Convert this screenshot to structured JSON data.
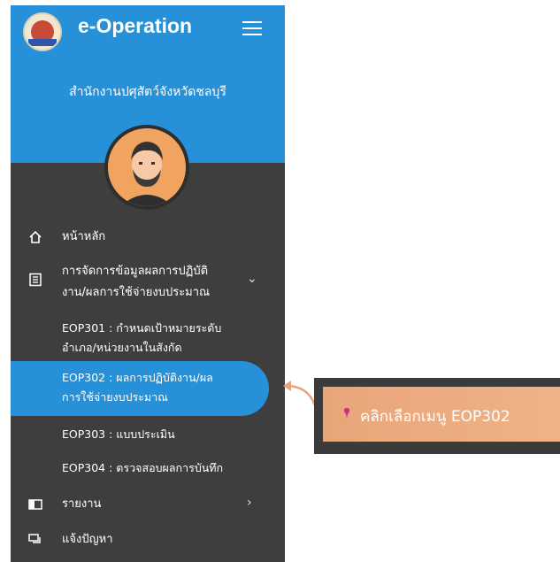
{
  "app": {
    "title": "e-Operation"
  },
  "header": {
    "org_name": "สำนักงานปศุสัตว์จังหวัดชลบุรี"
  },
  "nav": {
    "home": "หน้าหลัก",
    "manage": {
      "line1": "การจัดการข้อมูลผลการปฏิบัติ",
      "line2": "งาน/ผลการใช้จ่ายงบประมาณ"
    },
    "sub": [
      {
        "line1": "EOP301 : กำหนดเป้าหมายระดับ",
        "line2": "อำเภอ/หน่วยงานในสังกัด"
      },
      {
        "line1": "EOP302 : ผลการปฏิบัติงาน/ผล",
        "line2": "การใช้จ่ายงบประมาณ"
      },
      {
        "line1": "EOP303 : แบบประเมิน"
      },
      {
        "line1": "EOP304 : ตรวจสอบผลการบันทึก"
      }
    ],
    "report": "รายงาน",
    "problem": "แจ้งปัญหา"
  },
  "callout": {
    "text": "คลิกเลือกเมนู EOP302"
  },
  "colors": {
    "sidebar": "#3e3e3e",
    "accent": "#2690d8",
    "callout": "#eea87e"
  },
  "icons": [
    "app-logo",
    "hamburger-icon",
    "home-icon",
    "document-list-icon",
    "chevron-down-icon",
    "book-icon",
    "chevron-right-icon",
    "chat-icon",
    "pin-icon"
  ]
}
